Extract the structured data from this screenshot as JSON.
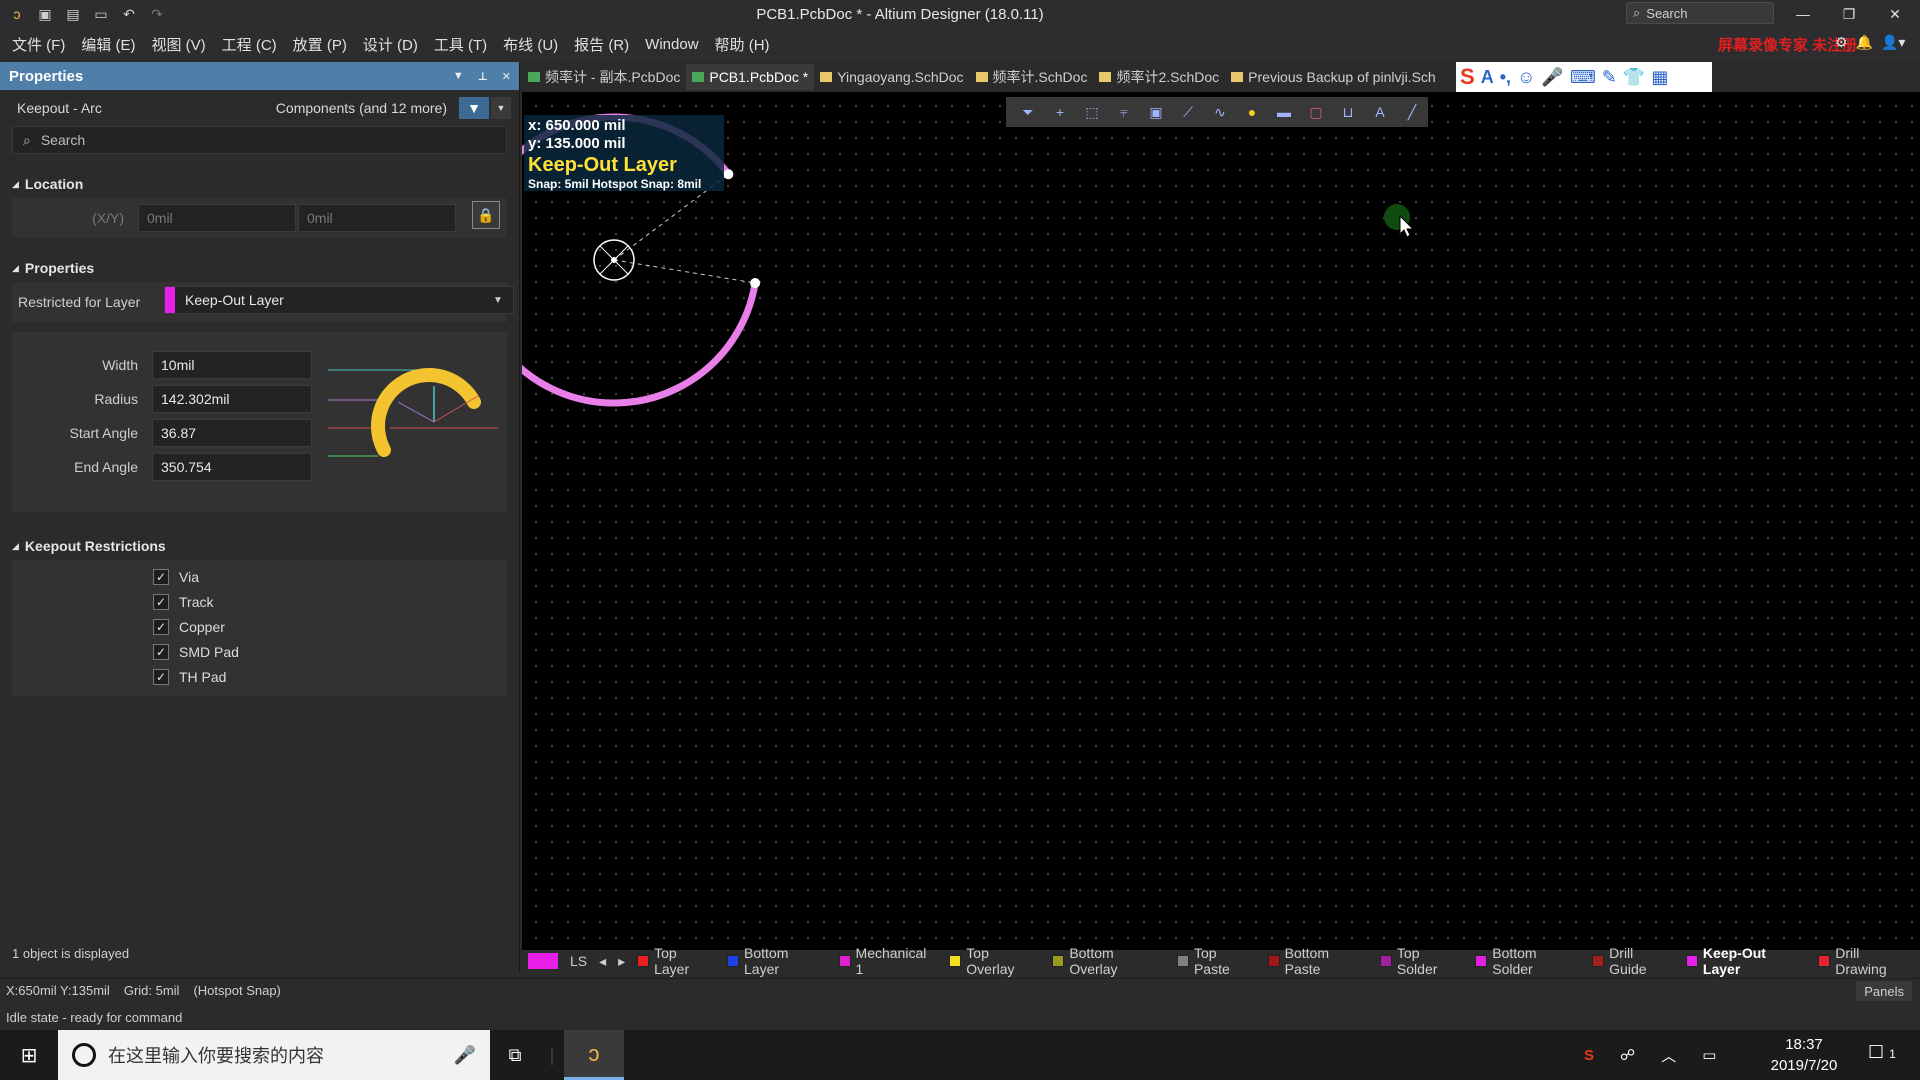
{
  "window": {
    "title": "PCB1.PcbDoc * - Altium Designer (18.0.11)",
    "search_placeholder": "Search"
  },
  "menu": [
    "文件 (F)",
    "编辑 (E)",
    "视图 (V)",
    "工程 (C)",
    "放置 (P)",
    "设计 (D)",
    "工具 (T)",
    "布线 (U)",
    "报告 (R)",
    "Window",
    "帮助 (H)"
  ],
  "menu_ad_text": "屏幕录像专家 未注册",
  "panel": {
    "title": "Properties",
    "object": "Keepout - Arc",
    "scope": "Components (and 12 more)",
    "search_placeholder": "Search",
    "location": {
      "title": "Location",
      "xy_label": "(X/Y)",
      "x": "0mil",
      "y": "0mil"
    },
    "properties": {
      "title": "Properties",
      "layer_label": "Restricted for Layer",
      "layer_value": "Keep-Out Layer",
      "layer_color": "#e81fe8",
      "fields": [
        {
          "label": "Width",
          "value": "10mil"
        },
        {
          "label": "Radius",
          "value": "142.302mil"
        },
        {
          "label": "Start Angle",
          "value": "36.87"
        },
        {
          "label": "End Angle",
          "value": "350.754"
        }
      ]
    },
    "keepout": {
      "title": "Keepout Restrictions",
      "items": [
        {
          "label": "Via",
          "checked": true
        },
        {
          "label": "Track",
          "checked": true
        },
        {
          "label": "Copper",
          "checked": true
        },
        {
          "label": "SMD Pad",
          "checked": true
        },
        {
          "label": "TH Pad",
          "checked": true
        }
      ]
    },
    "footer": "1 object is displayed"
  },
  "tabs": [
    {
      "label": "频率计 - 副本.PcbDoc",
      "type": "pcb",
      "active": false
    },
    {
      "label": "PCB1.PcbDoc *",
      "type": "pcb",
      "active": true
    },
    {
      "label": "Yingaoyang.SchDoc",
      "type": "sch",
      "active": false
    },
    {
      "label": "频率计.SchDoc",
      "type": "sch",
      "active": false
    },
    {
      "label": "频率计2.SchDoc",
      "type": "sch",
      "active": false
    },
    {
      "label": "Previous Backup of pinlvji.Sch",
      "type": "sch",
      "active": false
    }
  ],
  "hud": {
    "x": "x:   650.000 mil",
    "y": "y:   135.000 mil",
    "layer": "Keep-Out Layer",
    "snap": "Snap: 5mil Hotspot Snap: 8mil"
  },
  "arc": {
    "start_angle": 36.87,
    "end_angle": 350.754,
    "color": "#e87ee8"
  },
  "layers": [
    {
      "label": "Top Layer",
      "color": "#e82020",
      "active": false
    },
    {
      "label": "Bottom Layer",
      "color": "#2040e8",
      "active": false
    },
    {
      "label": "Mechanical 1",
      "color": "#e020d0",
      "active": false
    },
    {
      "label": "Top Overlay",
      "color": "#f0e020",
      "active": false
    },
    {
      "label": "Bottom Overlay",
      "color": "#9a9a20",
      "active": false
    },
    {
      "label": "Top Paste",
      "color": "#808080",
      "active": false
    },
    {
      "label": "Bottom Paste",
      "color": "#a01818",
      "active": false
    },
    {
      "label": "Top Solder",
      "color": "#a020a0",
      "active": false
    },
    {
      "label": "Bottom Solder",
      "color": "#e020e0",
      "active": false
    },
    {
      "label": "Drill Guide",
      "color": "#a02020",
      "active": false
    },
    {
      "label": "Keep-Out Layer",
      "color": "#e81fe8",
      "active": true
    },
    {
      "label": "Drill Drawing",
      "color": "#e82030",
      "active": false
    }
  ],
  "layer_ls": "LS",
  "status": {
    "coords": "X:650mil Y:135mil",
    "grid": "Grid: 5mil",
    "snap": "(Hotspot Snap)",
    "panels": "Panels",
    "state": "Idle state - ready for command"
  },
  "taskbar": {
    "search_placeholder": "在这里输入你要搜索的内容",
    "time": "18:37",
    "date": "2019/7/20",
    "notif_count": "1"
  }
}
